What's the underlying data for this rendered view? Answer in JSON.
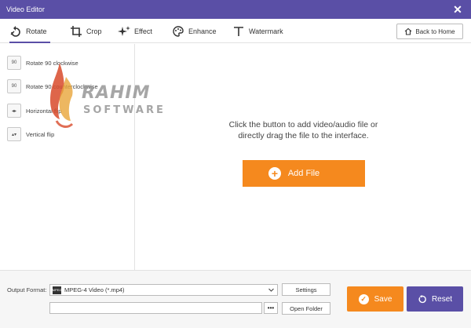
{
  "window": {
    "title": "Video Editor",
    "close_icon": "close-icon"
  },
  "tabs": [
    {
      "label": "Rotate",
      "icon": "rotate-icon",
      "active": true
    },
    {
      "label": "Crop",
      "icon": "crop-icon",
      "active": false
    },
    {
      "label": "Effect",
      "icon": "effect-sparkle-icon",
      "active": false
    },
    {
      "label": "Enhance",
      "icon": "palette-icon",
      "active": false
    },
    {
      "label": "Watermark",
      "icon": "text-t-icon",
      "active": false
    }
  ],
  "back_home": {
    "label": "Back to Home",
    "icon": "home-icon"
  },
  "sidebar": {
    "items": [
      {
        "label": "Rotate 90 clockwise",
        "icon": "rotate-cw-icon",
        "icon_text": "90"
      },
      {
        "label": "Rotate 90 counterclockwise",
        "icon": "rotate-ccw-icon",
        "icon_text": "90"
      },
      {
        "label": "Horizontal flip",
        "icon": "flip-horizontal-icon",
        "icon_text": "◂▸"
      },
      {
        "label": "Vertical flip",
        "icon": "flip-vertical-icon",
        "icon_text": "▴▾"
      }
    ]
  },
  "main": {
    "hint_line1": "Click the button to add video/audio file or",
    "hint_line2": "directly drag the file to the interface.",
    "add_file_label": "Add File"
  },
  "output": {
    "label": "Output Format:",
    "format_value": "MPEG-4 Video (*.mp4)",
    "format_icon_text": "MPEG",
    "settings_label": "Settings",
    "path_value": "",
    "browse_label": "•••",
    "open_folder_label": "Open Folder"
  },
  "actions": {
    "save_label": "Save",
    "reset_label": "Reset"
  },
  "watermark": {
    "brand": "RAHIM",
    "sub": "SOFTWARE"
  },
  "colors": {
    "accent": "#5a4fa6",
    "orange": "#f5891e"
  }
}
